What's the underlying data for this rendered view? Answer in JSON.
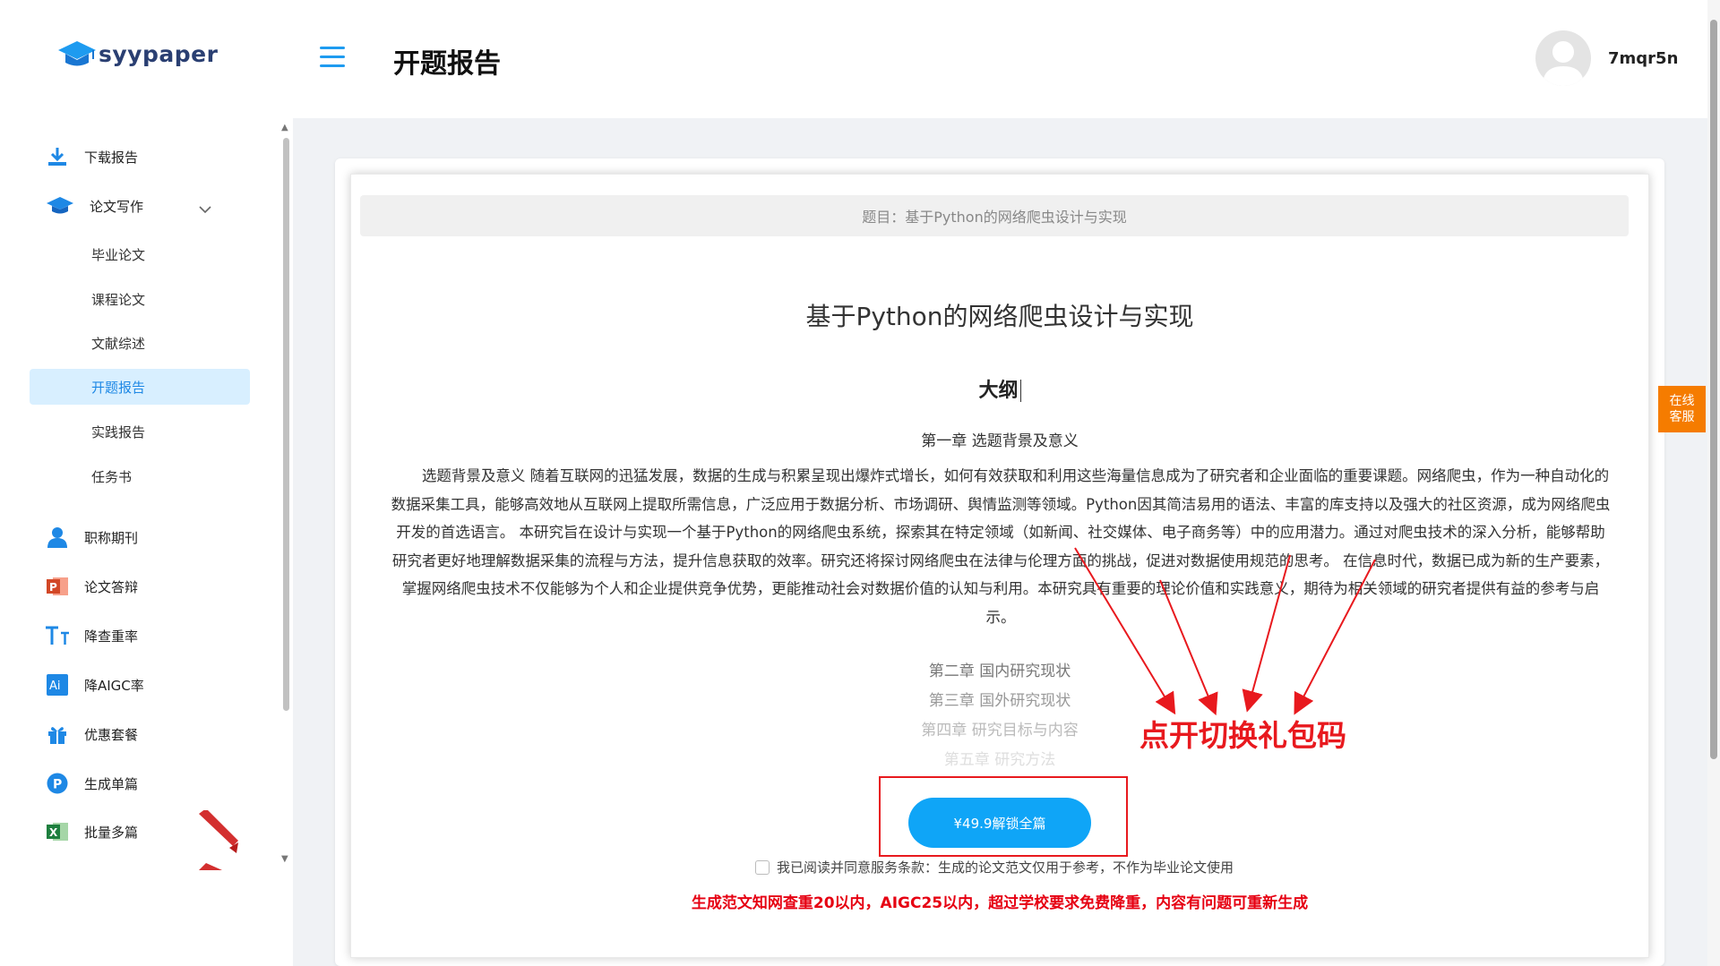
{
  "app": {
    "logo_text": "syypaper"
  },
  "header": {
    "title": "开题报告",
    "username": "7mqr5n"
  },
  "sidebar": {
    "items": [
      {
        "label": "下载报告",
        "icon": "download-icon"
      },
      {
        "label": "论文写作",
        "icon": "graduation-cap-icon"
      },
      {
        "label": "职称期刊",
        "icon": "user-icon"
      },
      {
        "label": "论文答辩",
        "icon": "powerpoint-icon"
      },
      {
        "label": "降查重率",
        "icon": "text-size-icon"
      },
      {
        "label": "降AIGC率",
        "icon": "ai-icon"
      },
      {
        "label": "优惠套餐",
        "icon": "gift-icon"
      },
      {
        "label": "生成单篇",
        "icon": "p-circle-icon"
      },
      {
        "label": "批量多篇",
        "icon": "excel-icon"
      }
    ],
    "sub_items": [
      "毕业论文",
      "课程论文",
      "文献综述",
      "开题报告",
      "实践报告",
      "任务书"
    ],
    "active_sub": "开题报告"
  },
  "document": {
    "topic_bar": "题目：基于Python的网络爬虫设计与实现",
    "title": "基于Python的网络爬虫设计与实现",
    "outline_heading": "大纲",
    "chapter1": "第一章 选题背景及意义",
    "paragraph": "选题背景及意义 随着互联网的迅猛发展，数据的生成与积累呈现出爆炸式增长，如何有效获取和利用这些海量信息成为了研究者和企业面临的重要课题。网络爬虫，作为一种自动化的数据采集工具，能够高效地从互联网上提取所需信息，广泛应用于数据分析、市场调研、舆情监测等领域。Python因其简洁易用的语法、丰富的库支持以及强大的社区资源，成为网络爬虫开发的首选语言。 本研究旨在设计与实现一个基于Python的网络爬虫系统，探索其在特定领域（如新闻、社交媒体、电子商务等）中的应用潜力。通过对爬虫技术的深入分析，能够帮助研究者更好地理解数据采集的流程与方法，提升信息获取的效率。研究还将探讨网络爬虫在法律与伦理方面的挑战，促进对数据使用规范的思考。 在信息时代，数据已成为新的生产要素，掌握网络爬虫技术不仅能够为个人和企业提供竞争优势，更能推动社会对数据价值的认知与利用。本研究具有重要的理论价值和实践意义，期待为相关领域的研究者提供有益的参考与启示。",
    "chapters": [
      "第二章 国内研究现状",
      "第三章 国外研究现状",
      "第四章 研究目标与内容",
      "第五章 研究方法"
    ]
  },
  "unlock_button": "¥49.9解锁全篇",
  "agreement": "我已阅读并同意服务条款：生成的论文范文仅用于参考，不作为毕业论文使用",
  "notice": "生成范文知网查重20以内，AIGC25以内，超过学校要求免费降重，内容有问题可重新生成",
  "annotation": "点开切换礼包码",
  "customer_service": {
    "line1": "在线",
    "line2": "客服"
  },
  "colors": {
    "accent": "#0fa5f7",
    "annotation_red": "#e8191e",
    "notice_red": "#e60012",
    "cs_orange": "#f57c00"
  }
}
